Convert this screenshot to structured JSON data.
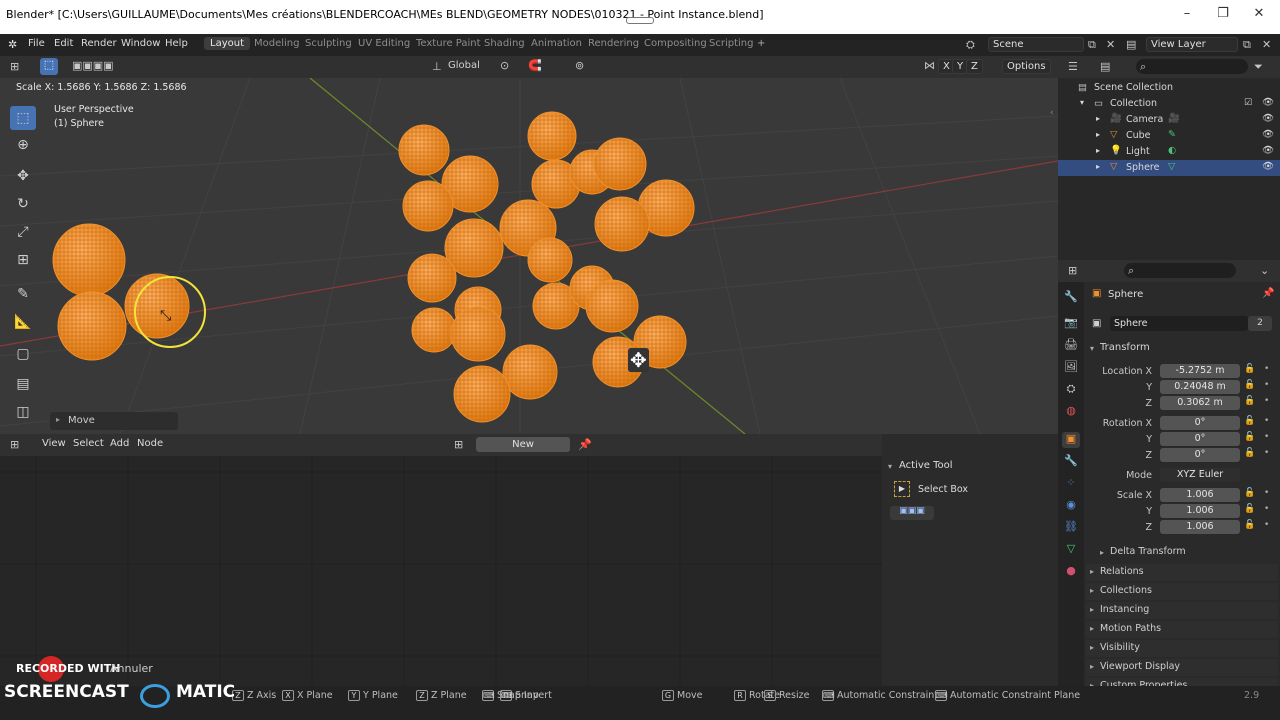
{
  "window": {
    "title": "Blender* [C:\\Users\\GUILLAUME\\Documents\\Mes créations\\BLENDERCOACH\\MEs BLEND\\GEOMETRY NODES\\010321 - Point Instance.blend]",
    "minimize": "–",
    "maximize": "❐",
    "close": "✕"
  },
  "menu": [
    "File",
    "Edit",
    "Render",
    "Window",
    "Help"
  ],
  "workspaces": [
    "Layout",
    "Modeling",
    "Sculpting",
    "UV Editing",
    "Texture Paint",
    "Shading",
    "Animation",
    "Rendering",
    "Compositing",
    "Scripting"
  ],
  "workspace_add": "+",
  "scene": {
    "name": "Scene",
    "view_layer": "View Layer"
  },
  "viewport": {
    "scale_readout": "Scale X: 1.5686   Y: 1.5686   Z: 1.5686",
    "orientation": "Global",
    "perspective": "User Perspective",
    "object": "(1) Sphere",
    "axes": [
      "X",
      "Y",
      "Z"
    ],
    "options": "Options",
    "last_op": "Move"
  },
  "node_editor": {
    "menus": [
      "View",
      "Select",
      "Add",
      "Node"
    ],
    "new_button": "New",
    "active_tool_title": "Active Tool",
    "active_tool_name": "Select Box"
  },
  "outliner": {
    "root": "Scene Collection",
    "collection": "Collection",
    "items": [
      {
        "name": "Camera",
        "icon": "camera-icon",
        "color": "#e08a3c"
      },
      {
        "name": "Cube",
        "icon": "mesh-icon",
        "color": "#e08a3c"
      },
      {
        "name": "Light",
        "icon": "light-icon",
        "color": "#e08a3c"
      },
      {
        "name": "Sphere",
        "icon": "mesh-icon",
        "color": "#e08a3c"
      }
    ]
  },
  "properties": {
    "object_name": "Sphere",
    "datablock_name": "Sphere",
    "datablock_users": "2",
    "transform_title": "Transform",
    "location": {
      "label": "Location X",
      "x": "-5.2752 m",
      "y": "0.24048 m",
      "z": "0.3062 m"
    },
    "rotation": {
      "label": "Rotation X",
      "x": "0°",
      "y": "0°",
      "z": "0°"
    },
    "mode": {
      "label": "Mode",
      "value": "XYZ Euler"
    },
    "scale": {
      "label": "Scale X",
      "x": "1.006",
      "y": "1.006",
      "z": "1.006"
    },
    "axis_y": "Y",
    "axis_z": "Z",
    "delta": "Delta Transform",
    "panels": [
      "Relations",
      "Collections",
      "Instancing",
      "Motion Paths",
      "Visibility",
      "Viewport Display",
      "Custom Properties"
    ]
  },
  "statusbar": {
    "items": [
      "Z Axis",
      "X Plane",
      "Y Plane",
      "Z Plane",
      "Snap Invert",
      "Snap",
      "Move",
      "Rotate",
      "Resize",
      "Automatic Constraint",
      "Automatic Constraint Plane"
    ],
    "keys": [
      "Z",
      "X",
      "Y",
      "Z",
      "",
      "",
      "G",
      "R",
      "S",
      "",
      ""
    ],
    "version": "2.9"
  },
  "watermark": {
    "line1": "RECORDED WITH",
    "line2": "SCREENCAST",
    "line3": "MATIC",
    "cancel": "Annuler"
  },
  "colors": {
    "accent": "#4772b3",
    "sphere": "#f0902a",
    "selected_row": "#334d80"
  },
  "spheres_count": 26
}
